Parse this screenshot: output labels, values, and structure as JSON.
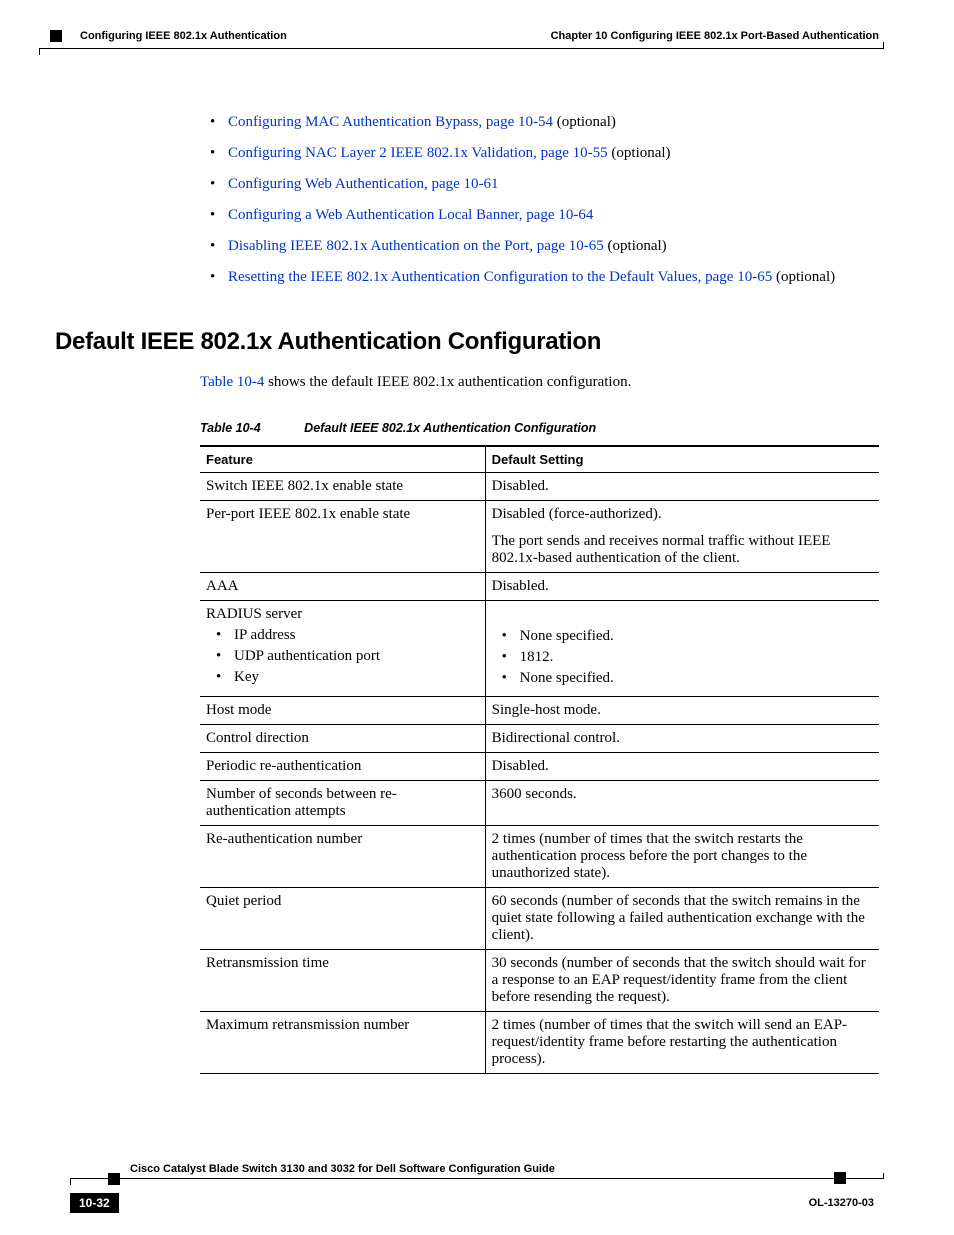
{
  "header": {
    "chapter": "Chapter 10    Configuring IEEE 802.1x Port-Based Authentication",
    "section": "Configuring IEEE 802.1x Authentication"
  },
  "toc": [
    {
      "link": "Configuring MAC Authentication Bypass, page 10-54",
      "suffix": " (optional)"
    },
    {
      "link": "Configuring NAC Layer 2 IEEE 802.1x Validation, page 10-55",
      "suffix": " (optional)"
    },
    {
      "link": "Configuring Web Authentication, page 10-61",
      "suffix": ""
    },
    {
      "link": "Configuring a Web Authentication Local Banner, page 10-64",
      "suffix": ""
    },
    {
      "link": "Disabling IEEE 802.1x Authentication on the Port, page 10-65",
      "suffix": " (optional)"
    },
    {
      "link": "Resetting the IEEE 802.1x Authentication Configuration to the Default Values, page 10-65",
      "suffix": " (optional)"
    }
  ],
  "heading": "Default IEEE 802.1x Authentication Configuration",
  "intro_prefix": "Table 10-4",
  "intro_suffix": " shows the default IEEE 802.1x authentication configuration.",
  "table": {
    "caption_num": "Table 10-4",
    "caption_title": "Default IEEE 802.1x Authentication Configuration",
    "col1": "Feature",
    "col2": "Default Setting",
    "rows": {
      "r1f": "Switch IEEE 802.1x enable state",
      "r1d": "Disabled.",
      "r2f": "Per-port IEEE 802.1x enable state",
      "r2d1": "Disabled (force-authorized).",
      "r2d2": "The port sends and receives normal traffic without IEEE 802.1x-based authentication of the client.",
      "r3f": "AAA",
      "r3d": "Disabled.",
      "r4f": "RADIUS server",
      "r4s1": "IP address",
      "r4s2": "UDP authentication port",
      "r4s3": "Key",
      "r4d1": "None specified.",
      "r4d2": "1812.",
      "r4d3": "None specified.",
      "r5f": "Host mode",
      "r5d": "Single-host mode.",
      "r6f": "Control direction",
      "r6d": "Bidirectional control.",
      "r7f": "Periodic re-authentication",
      "r7d": "Disabled.",
      "r8f": "Number of seconds between re-authentication attempts",
      "r8d": "3600 seconds.",
      "r9f": "Re-authentication number",
      "r9d": "2 times (number of times that the switch restarts the authentication process before the port changes to the unauthorized state).",
      "r10f": "Quiet period",
      "r10d": "60 seconds (number of seconds that the switch remains in the quiet state following a failed authentication exchange with the client).",
      "r11f": "Retransmission time",
      "r11d": "30 seconds (number of seconds that the switch should wait for a response to an EAP request/identity frame from the client before resending the request).",
      "r12f": "Maximum retransmission number",
      "r12d": "2 times (number of times that the switch will send an EAP-request/identity frame before restarting the authentication process)."
    }
  },
  "footer": {
    "title": "Cisco Catalyst Blade Switch 3130 and 3032 for Dell Software Configuration Guide",
    "page": "10-32",
    "docid": "OL-13270-03"
  }
}
